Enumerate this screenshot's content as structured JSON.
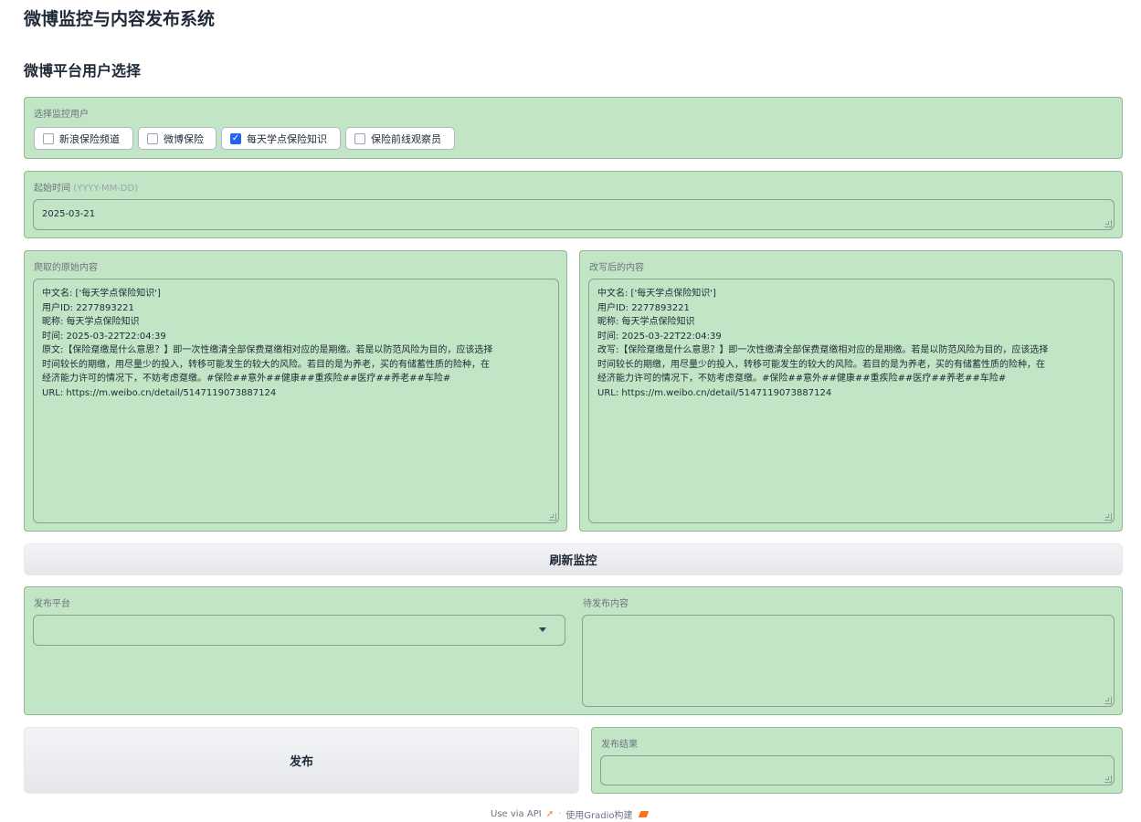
{
  "header": {
    "title": "微博监控与内容发布系统",
    "subtitle": "微博平台用户选择"
  },
  "monitor_users": {
    "label": "选择监控用户",
    "options": [
      {
        "label": "新浪保险频道",
        "checked": false
      },
      {
        "label": "微博保险",
        "checked": false
      },
      {
        "label": "每天学点保险知识",
        "checked": true
      },
      {
        "label": "保险前线观察员",
        "checked": false
      }
    ]
  },
  "start_time": {
    "label": "起始时间",
    "hint": "(YYYY-MM-DD)",
    "value": "2025-03-21"
  },
  "original_content": {
    "label": "爬取的原始内容",
    "lines": [
      "中文名: ['每天学点保险知识']",
      "用户ID: 2277893221",
      "昵称: 每天学点保险知识",
      "时间: 2025-03-22T22:04:39",
      "原文:【保险趸缴是什么意思？】即一次性缴清全部保费趸缴相对应的是期缴。若是以防范风险为目的，应该选择",
      "时间较长的期缴，用尽量少的投入，转移可能发生的较大的风险。若目的是为养老，买的有储蓄性质的险种，在",
      "经济能力许可的情况下，不妨考虑趸缴。#保险##意外##健康##重疾险##医疗##养老##车险#",
      "URL: https://m.weibo.cn/detail/5147119073887124"
    ]
  },
  "rewritten_content": {
    "label": "改写后的内容",
    "lines": [
      "中文名: ['每天学点保险知识']",
      "用户ID: 2277893221",
      "昵称: 每天学点保险知识",
      "时间: 2025-03-22T22:04:39",
      "改写:【保险趸缴是什么意思？】即一次性缴清全部保费趸缴相对应的是期缴。若是以防范风险为目的，应该选择",
      "时间较长的期缴，用尽量少的投入，转移可能发生的较大的风险。若目的是为养老，买的有储蓄性质的险种，在",
      "经济能力许可的情况下，不妨考虑趸缴。#保险##意外##健康##重疾险##医疗##养老##车险#",
      "URL: https://m.weibo.cn/detail/5147119073887124"
    ]
  },
  "refresh_button": "刷新监控",
  "publish": {
    "platform_label": "发布平台",
    "platform_value": "",
    "content_label": "待发布内容",
    "content_value": "",
    "button": "发布",
    "result_label": "发布结果",
    "result_value": ""
  },
  "footer": {
    "api": "Use via API",
    "built": "使用Gradio构建"
  },
  "colors": {
    "panel": "#c2e5c5",
    "checkbox_on": "#2563eb"
  },
  "icons": [
    "rocket-icon",
    "gradio-logo-icon",
    "chevron-down-icon",
    "checkmark-icon"
  ]
}
